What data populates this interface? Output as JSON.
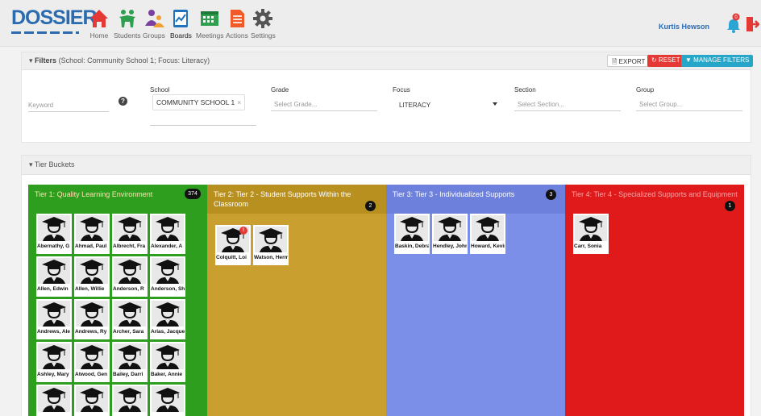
{
  "app": {
    "logo_text": "DOSSIER",
    "logo_sub": "IMPLEMENTATION"
  },
  "nav": [
    {
      "label": "Home",
      "icon": "home-icon",
      "color": "#e53935"
    },
    {
      "label": "Students",
      "icon": "students-icon",
      "color": "#2e9e4f"
    },
    {
      "label": "Groups",
      "icon": "groups-icon",
      "color": "#7b3fa0"
    },
    {
      "label": "Boards",
      "icon": "boards-icon",
      "color": "#1e73be"
    },
    {
      "label": "Meetings",
      "icon": "meetings-icon",
      "color": "#2e9e4f"
    },
    {
      "label": "Actions",
      "icon": "actions-icon",
      "color": "#f05a28"
    },
    {
      "label": "Settings",
      "icon": "gear-icon",
      "color": "#555555"
    }
  ],
  "user": {
    "name": "Kurtis Hewson",
    "notification_count": "0"
  },
  "filters": {
    "title": "Filters",
    "summary": "(School: Community School 1; Focus: Literacy)",
    "export_label": "EXPORT",
    "reset_label": "RESET",
    "manage_label": "MANAGE FILTERS",
    "keyword_placeholder": "Keyword",
    "school_label": "School",
    "school_value": "COMMUNITY SCHOOL 1",
    "grade_label": "Grade",
    "grade_placeholder": "Select Grade...",
    "focus_label": "Focus",
    "focus_value": "LITERACY",
    "section_label": "Section",
    "section_placeholder": "Select Section...",
    "group_label": "Group",
    "group_placeholder": "Select Group..."
  },
  "tier_buckets": {
    "title": "Tier Buckets"
  },
  "tiers": [
    {
      "title": "Tier 1: Quality Learning Environment",
      "count": "374",
      "color": "#2e9e1f",
      "students": [
        "Abernathy, G",
        "Ahmad, Paul",
        "Albrecht, Fra",
        "Alexander, A",
        "Allen, Edwin",
        "Allen, Willie",
        "Anderson, R",
        "Anderson, Sha",
        "Andrews, Ale",
        "Andrews, Ry",
        "Archer, Sara",
        "Arias, Jacque",
        "Ashley, Mary",
        "Atwood, Gen",
        "Bailey, Darri",
        "Baker, Annie",
        "",
        "",
        "",
        ""
      ]
    },
    {
      "title": "Tier 2: Tier 2 - Student Supports Within the Classroom",
      "count": "2",
      "color": "#c9a030",
      "students": [
        "Colquitt, Loi",
        "Watson, Herma"
      ]
    },
    {
      "title": "Tier 3: Tier 3 - Individualized Supports",
      "count": "3",
      "color": "#7b8ee8",
      "students": [
        "Baskin, Debra",
        "Hendley, John",
        "Howard, Kevin"
      ]
    },
    {
      "title": "Tier 4: Tier 4 - Specialized Supports and Equipment",
      "count": "1",
      "color": "#e0191b",
      "students": [
        "Carr, Sonia"
      ]
    }
  ]
}
